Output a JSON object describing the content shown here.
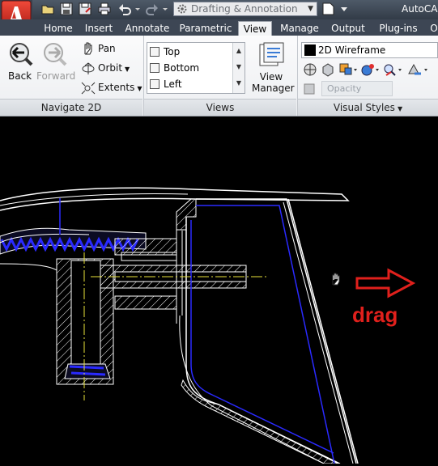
{
  "titlebar": {
    "workspace": "Drafting & Annotation",
    "app_title": "AutoCAD"
  },
  "tabs": [
    {
      "label": "Home"
    },
    {
      "label": "Insert"
    },
    {
      "label": "Annotate"
    },
    {
      "label": "Parametric"
    },
    {
      "label": "View",
      "active": true
    },
    {
      "label": "Manage"
    },
    {
      "label": "Output"
    },
    {
      "label": "Plug-ins"
    },
    {
      "label": "O"
    }
  ],
  "ribbon": {
    "navigate": {
      "title": "Navigate 2D",
      "back": "Back",
      "forward": "Forward",
      "pan": "Pan",
      "orbit": "Orbit",
      "extents": "Extents"
    },
    "views": {
      "title": "Views",
      "items": [
        "Top",
        "Bottom",
        "Left"
      ],
      "view_manager": [
        "View",
        "Manager"
      ]
    },
    "visual_styles": {
      "title": "Visual Styles",
      "current": "2D Wireframe",
      "opacity_placeholder": "Opacity"
    }
  },
  "canvas": {
    "annotation": "drag",
    "annotation_color": "#e0201c",
    "cursor": "pan-hand-icon"
  },
  "colors": {
    "drawing_white": "#ffffff",
    "drawing_blue": "#2a2aff",
    "centerline_yellow": "#e8e23a"
  }
}
